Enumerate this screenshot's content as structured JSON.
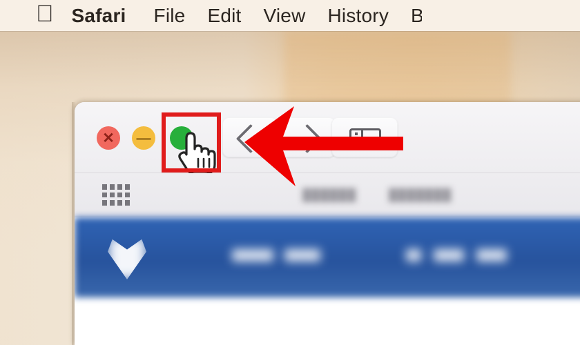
{
  "menubar": {
    "apple_logo": "apple-logo",
    "items": [
      {
        "label": "",
        "name": "apple-menu",
        "bold": false
      },
      {
        "label": "Safari",
        "name": "menu-safari",
        "bold": true
      },
      {
        "label": "File",
        "name": "menu-file",
        "bold": false
      },
      {
        "label": "Edit",
        "name": "menu-edit",
        "bold": false
      },
      {
        "label": "View",
        "name": "menu-view",
        "bold": false
      },
      {
        "label": "History",
        "name": "menu-history",
        "bold": false
      },
      {
        "label": "B",
        "name": "menu-bookmarks-clipped",
        "bold": false
      }
    ]
  },
  "window": {
    "traffic_lights": {
      "close": {
        "name": "close-button",
        "glyph": "✕",
        "color": "#f1685e"
      },
      "minimize": {
        "name": "minimize-button",
        "glyph": "—",
        "color": "#f4bd3e"
      },
      "zoom": {
        "name": "zoom-maximize-button",
        "glyph": "",
        "color": "#1fac33"
      }
    },
    "toolbar": {
      "back_label": "back-chevron",
      "forward_label": "forward-chevron",
      "sidebar_label": "sidebar-toggle"
    },
    "bookmarks_bar": {
      "grid_label": "favorites-grid",
      "blurred_items": [
        "██████",
        "███████"
      ]
    },
    "page": {
      "site_logo": "site-logo-white",
      "header_color": "#27539d",
      "nav_items": [
        "",
        "",
        ""
      ]
    }
  },
  "annotation": {
    "highlight_color": "#e01b1b",
    "highlight_target": "zoom-maximize-button",
    "arrow_color": "#ee0000",
    "arrow_direction": "left",
    "cursor_type": "pointing-hand"
  },
  "colors": {
    "menubar_bg": "#f8f0e6",
    "desktop_bg": "#f0e4d2",
    "window_bg": "#f3f2f4",
    "toolbar_bg": "#eeedf0",
    "green": "#1fac33",
    "yellow": "#f4bd3e",
    "red": "#f1685e"
  }
}
